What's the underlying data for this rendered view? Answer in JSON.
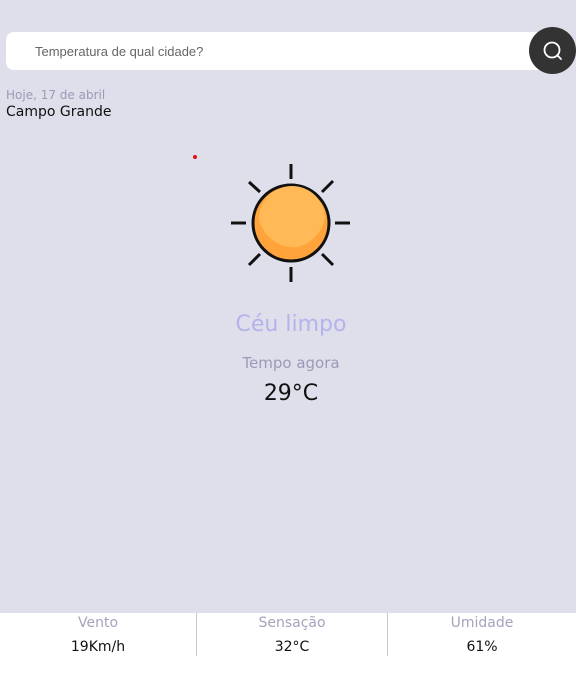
{
  "search": {
    "placeholder": "Temperatura de qual cidade?",
    "button_icon": "search-icon"
  },
  "location": {
    "date": "Hoje, 17 de abril",
    "city": "Campo Grande"
  },
  "weather": {
    "icon": "sun-icon",
    "condition": "Céu limpo",
    "time_label": "Tempo agora",
    "temperature": "29°C"
  },
  "stats": [
    {
      "label": "Vento",
      "value": "19Km/h"
    },
    {
      "label": "Sensação",
      "value": "32°C"
    },
    {
      "label": "Umidade",
      "value": "61%"
    }
  ],
  "colors": {
    "background": "#dedfea",
    "search_button": "#333333",
    "condition_text": "#b4b3ec",
    "muted_text": "#9a9bb6",
    "sun_fill": "#ffa33a",
    "sun_highlight": "#ffb957",
    "stats_background": "#ffffff"
  }
}
